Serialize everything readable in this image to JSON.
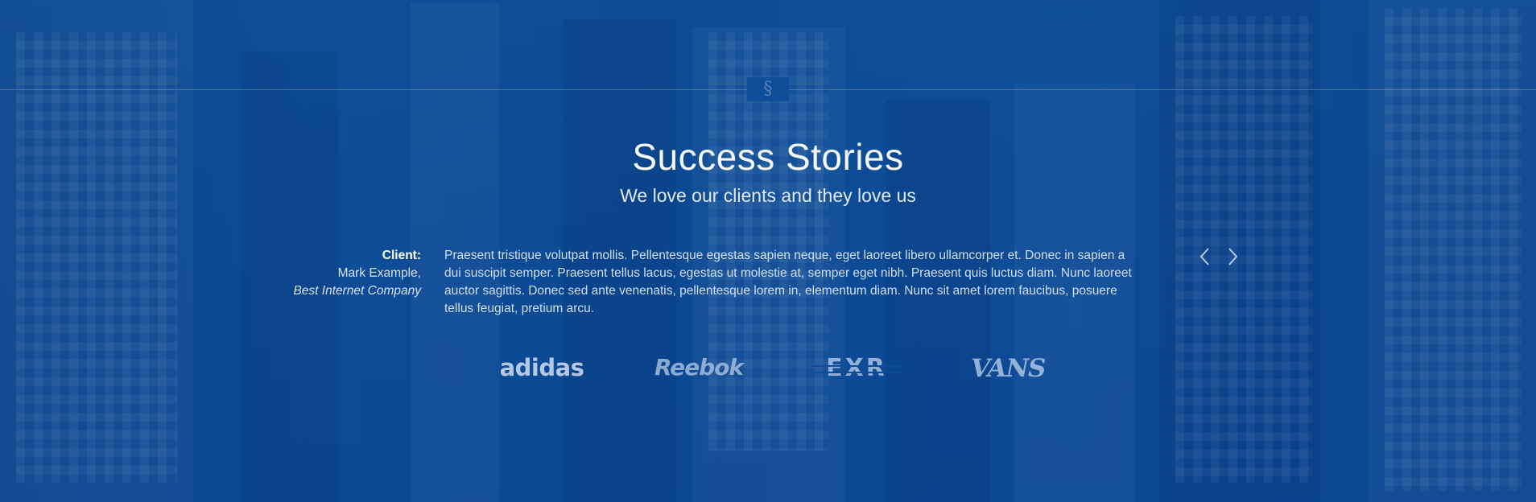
{
  "section": {
    "mark": "§",
    "title": "Success Stories",
    "subtitle": "We love our clients and they love us"
  },
  "testimonial": {
    "client_label": "Client:",
    "client_name": "Mark Example,",
    "client_company": "Best Internet Company",
    "quote": "Praesent tristique volutpat mollis. Pellentesque egestas sapien neque, eget laoreet libero ullamcorper et. Donec in sapien a dui suscipit semper. Praesent tellus lacus, egestas ut molestie at, semper eget nibh. Praesent quis luctus diam. Nunc laoreet auctor sagittis. Donec sed ante venenatis, pellentesque lorem in, elementum diam. Nunc sit amet lorem faucibus, posuere tellus feugiat, pretium arcu."
  },
  "navigation": {
    "prev_icon": "chevron-left-icon",
    "next_icon": "chevron-right-icon"
  },
  "logos": [
    {
      "name": "adidas",
      "text": "adidas"
    },
    {
      "name": "reebok",
      "text": "Reebok"
    },
    {
      "name": "exr",
      "text": "EXR"
    },
    {
      "name": "vans",
      "text": "VANS"
    }
  ],
  "colors": {
    "background": "#0d4c96",
    "text": "#ffffff",
    "muted_text": "#d2dfef",
    "logo": "#aac3e2"
  }
}
